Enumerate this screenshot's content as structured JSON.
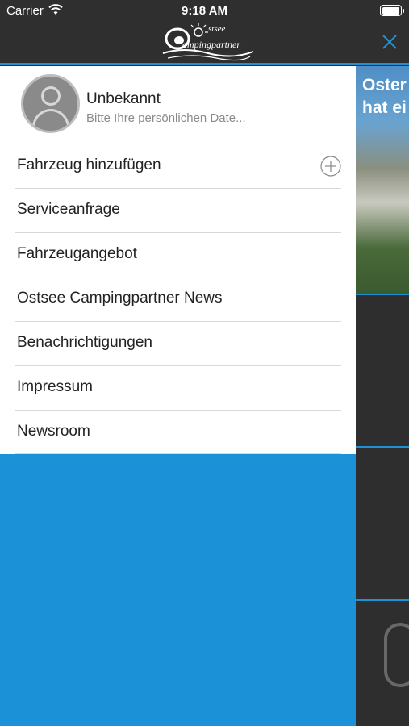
{
  "status_bar": {
    "carrier": "Carrier",
    "time": "9:18 AM",
    "battery_level": 1.0
  },
  "header": {
    "logo_text": "ampingpartner",
    "logo_top_text": "stsee"
  },
  "profile": {
    "name": "Unbekannt",
    "subtitle": "Bitte Ihre persönlichen Date..."
  },
  "menu": {
    "items": [
      {
        "label": "Fahrzeug hinzufügen",
        "icon": "plus-circle-icon"
      },
      {
        "label": "Serviceanfrage"
      },
      {
        "label": "Fahrzeugangebot"
      },
      {
        "label": "Ostsee Campingpartner News"
      },
      {
        "label": "Benachrichtigungen"
      },
      {
        "label": "Impressum"
      },
      {
        "label": "Newsroom"
      }
    ]
  },
  "background": {
    "card_title": "Oster\nhat ei"
  },
  "colors": {
    "accent": "#1b92d8",
    "header_bg": "#2f2f2f",
    "panel_bg": "#ffffff"
  }
}
